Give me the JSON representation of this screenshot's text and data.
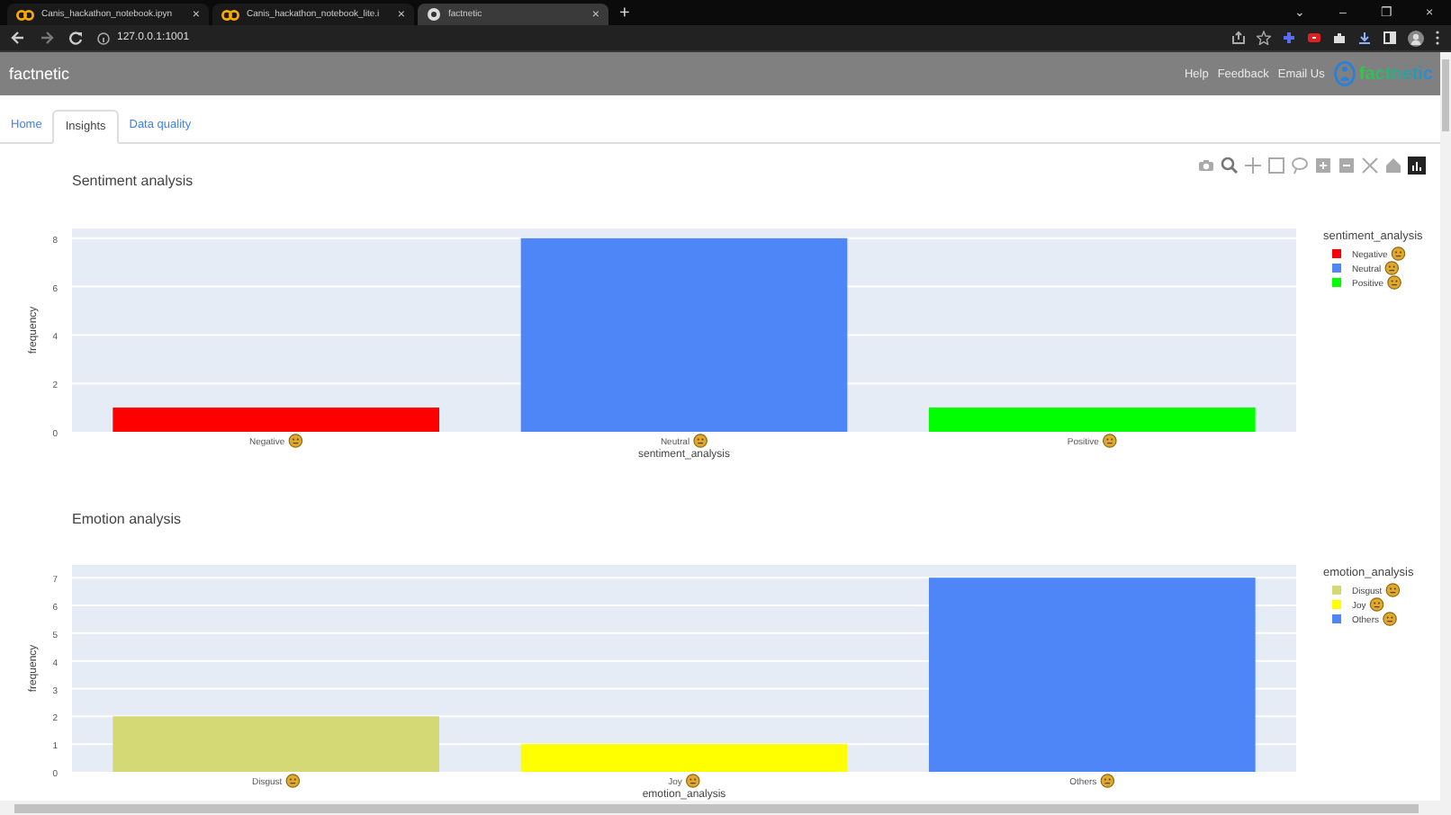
{
  "browser": {
    "tabs": [
      {
        "title": "Canis_hackathon_notebook.ipyn",
        "close": "×",
        "selected": false
      },
      {
        "title": "Canis_hackathon_notebook_lite.i",
        "close": "×",
        "selected": false
      },
      {
        "title": "factnetic",
        "close": "×",
        "selected": true
      }
    ],
    "new_tab": "+",
    "window_controls": [
      "⌄",
      "–",
      "❐",
      "×"
    ],
    "address": "127.0.0.1:1001"
  },
  "header": {
    "title": "factnetic",
    "links": [
      "Help",
      "Feedback",
      "Email Us"
    ],
    "logo_text": "factnetic"
  },
  "nav_tabs": [
    {
      "label": "Home",
      "selected": false
    },
    {
      "label": "Insights",
      "selected": true
    },
    {
      "label": "Data quality",
      "selected": false
    }
  ],
  "charts": [
    {
      "title": "Sentiment analysis",
      "modebar": true,
      "chart_data": {
        "type": "bar",
        "xlabel": "sentiment_analysis",
        "ylabel": "frequency",
        "categories": [
          "Negative",
          "Neutral",
          "Positive"
        ],
        "series": [
          {
            "name": "Negative",
            "color": "#ff0000",
            "values": [
              1,
              null,
              null
            ]
          },
          {
            "name": "Neutral",
            "color": "#4f86f7",
            "values": [
              null,
              8,
              null
            ]
          },
          {
            "name": "Positive",
            "color": "#00ff00",
            "values": [
              null,
              null,
              1
            ]
          }
        ],
        "ylim": [
          0,
          8.4
        ],
        "yticks": [
          0,
          2,
          4,
          6,
          8
        ],
        "grid": true,
        "legend": {
          "title": "sentiment_analysis"
        }
      }
    },
    {
      "title": "Emotion analysis",
      "modebar": false,
      "chart_data": {
        "type": "bar",
        "xlabel": "emotion_analysis",
        "ylabel": "frequency",
        "categories": [
          "Disgust",
          "Joy",
          "Others"
        ],
        "series": [
          {
            "name": "Disgust",
            "color": "#d4d975",
            "values": [
              2,
              null,
              null
            ]
          },
          {
            "name": "Joy",
            "color": "#ffff00",
            "values": [
              null,
              1,
              null
            ]
          },
          {
            "name": "Others",
            "color": "#4f86f7",
            "values": [
              null,
              null,
              7
            ]
          }
        ],
        "ylim": [
          0,
          7.46
        ],
        "yticks": [
          0,
          1,
          2,
          3,
          4,
          5,
          6,
          7
        ],
        "grid": true,
        "legend": {
          "title": "emotion_analysis"
        }
      }
    }
  ]
}
